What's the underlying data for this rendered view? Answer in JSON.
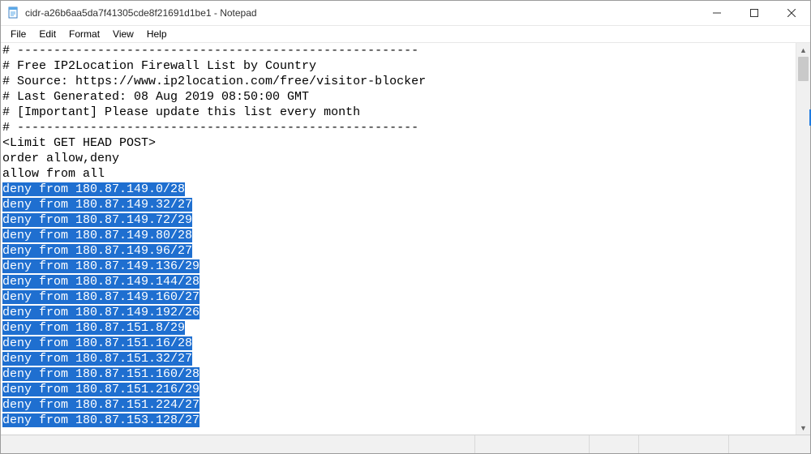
{
  "window": {
    "title": "cidr-a26b6aa5da7f41305cde8f21691d1be1 - Notepad"
  },
  "menu": {
    "file": "File",
    "edit": "Edit",
    "format": "Format",
    "view": "View",
    "help": "Help"
  },
  "content": {
    "plain_lines": [
      "# -------------------------------------------------------",
      "# Free IP2Location Firewall List by Country",
      "# Source: https://www.ip2location.com/free/visitor-blocker",
      "# Last Generated: 08 Aug 2019 08:50:00 GMT",
      "# [Important] Please update this list every month",
      "# -------------------------------------------------------",
      "<Limit GET HEAD POST>",
      "order allow,deny",
      "allow from all"
    ],
    "selected_lines": [
      "deny from 180.87.149.0/28",
      "deny from 180.87.149.32/27",
      "deny from 180.87.149.72/29",
      "deny from 180.87.149.80/28",
      "deny from 180.87.149.96/27",
      "deny from 180.87.149.136/29",
      "deny from 180.87.149.144/28",
      "deny from 180.87.149.160/27",
      "deny from 180.87.149.192/26",
      "deny from 180.87.151.8/29",
      "deny from 180.87.151.16/28",
      "deny from 180.87.151.32/27",
      "deny from 180.87.151.160/28",
      "deny from 180.87.151.216/29",
      "deny from 180.87.151.224/27",
      "deny from 180.87.153.128/27"
    ]
  }
}
